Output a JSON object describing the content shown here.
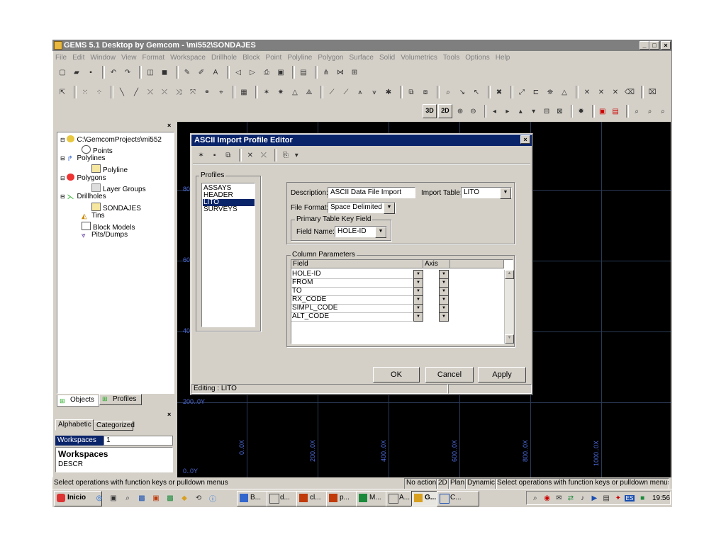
{
  "window": {
    "title": "GEMS 5.1 Desktop by Gemcom - \\mi552\\SONDAJES",
    "min": "_",
    "max": "□",
    "close": "×"
  },
  "menu": [
    "File",
    "Edit",
    "Window",
    "View",
    "Format",
    "Workspace",
    "Drillhole",
    "Block",
    "Point",
    "Polyline",
    "Polygon",
    "Surface",
    "Solid",
    "Volumetrics",
    "Tools",
    "Options",
    "Help"
  ],
  "view_buttons": {
    "b3d": "3D",
    "b2d": "2D"
  },
  "tree": {
    "root": "C:\\GemcomProjects\\mi552",
    "items": [
      "Points",
      "Polylines",
      "Polyline",
      "Polygons",
      "Layer Groups",
      "Drillholes",
      "SONDAJES",
      "Tins",
      "Block Models",
      "Pits/Dumps"
    ]
  },
  "left_tabs": {
    "objects": "Objects",
    "profiles": "Profiles"
  },
  "props": {
    "tab_alpha": "Alphabetic",
    "tab_cat": "Categorized",
    "row_label": "Workspaces",
    "row_value": "1",
    "heading": "Workspaces",
    "desc": "DESCR"
  },
  "canvas": {
    "y_labels": [
      "80",
      "60",
      "40",
      "200..0Y",
      "0..0Y"
    ],
    "x_labels": [
      "0..0X",
      "200..0X",
      "400..0X",
      "600..0X",
      "800..0X",
      "1000..0X"
    ]
  },
  "dialog": {
    "title": "ASCII Import Profile Editor",
    "close": "×",
    "profiles_label": "Profiles",
    "profiles": [
      "ASSAYS",
      "HEADER",
      "LITO",
      "SURVEYS"
    ],
    "selected_profile": "LITO",
    "description_label": "Description:",
    "description_value": "ASCII Data File Import",
    "import_table_label": "Import Table:",
    "import_table_value": "LITO",
    "file_format_label": "File Format:",
    "file_format_value": "Space Delimited",
    "primary_key_label": "Primary Table Key Field",
    "field_name_label": "Field Name:",
    "field_name_value": "HOLE-ID",
    "column_params_label": "Column Parameters",
    "col_field": "Field",
    "col_axis": "Axis",
    "fields": [
      "HOLE-ID",
      "FROM",
      "TO",
      "RX_CODE",
      "SIMPL_CODE",
      "ALT_CODE"
    ],
    "ok": "OK",
    "cancel": "Cancel",
    "apply": "Apply",
    "status": "Editing : LITO"
  },
  "statusbar": {
    "left": "Select operations with function keys or pulldown menus",
    "mode": "No action",
    "p2d": "2D",
    "plan": "Plan",
    "dyn": "Dynamic",
    "right": "Select operations with function keys or pulldown menus"
  },
  "taskbar": {
    "start": "Inicio",
    "tasks": [
      "B...",
      "d...",
      "cl...",
      "p...",
      "M...",
      "A...",
      "G...",
      "C..."
    ],
    "lang": "ES",
    "clock": "19:56"
  }
}
